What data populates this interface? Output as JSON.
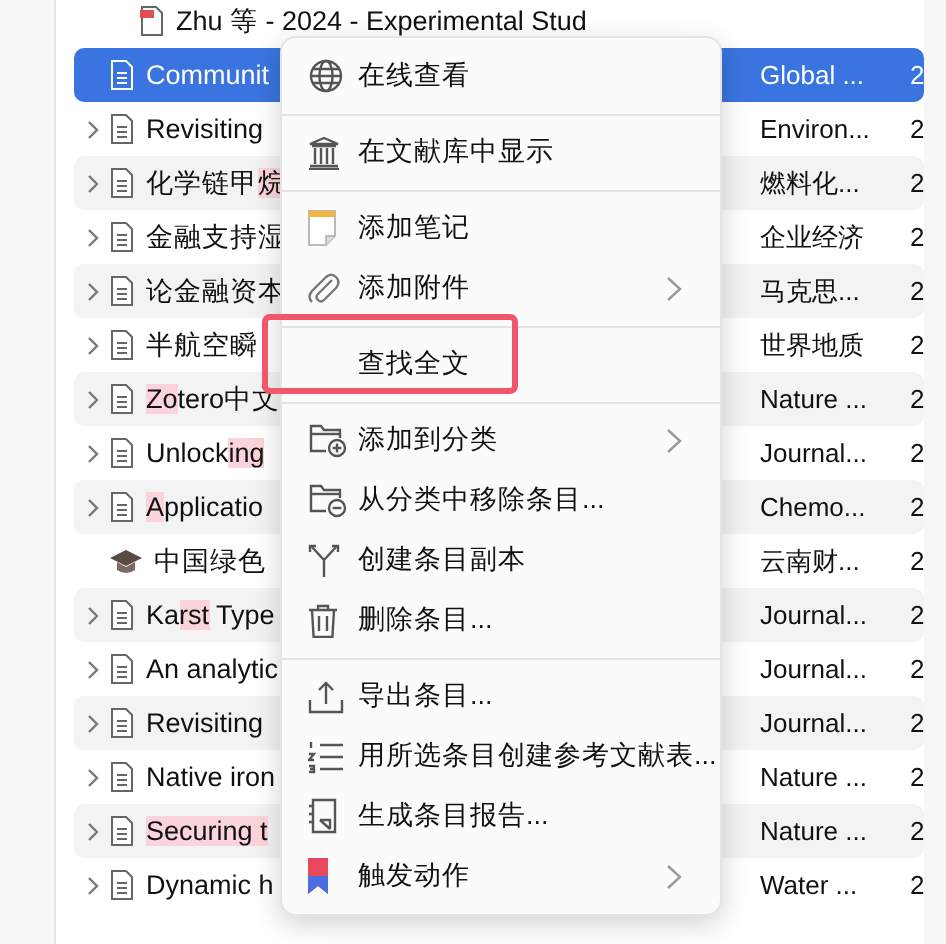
{
  "items": [
    {
      "kind": "attachment",
      "expandable": false,
      "selected": false,
      "title": [
        {
          "text": "Zhu 等 - 2024 - Experimental Stud",
          "hit": false
        }
      ]
    },
    {
      "kind": "article",
      "expandable": false,
      "selected": true,
      "title": [
        {
          "text": "Communit",
          "hit": false
        }
      ],
      "publication": "Global ...",
      "date": "2"
    },
    {
      "kind": "article",
      "expandable": true,
      "selected": false,
      "title": [
        {
          "text": "Revisiting",
          "hit": false
        }
      ],
      "publication": "Environ...",
      "date": "2"
    },
    {
      "kind": "article",
      "expandable": true,
      "selected": false,
      "title": [
        {
          "text": "化学链甲",
          "hit": false
        },
        {
          "text": "烷",
          "hit": true
        }
      ],
      "publication": "燃料化...",
      "date": "2"
    },
    {
      "kind": "article",
      "expandable": true,
      "selected": false,
      "title": [
        {
          "text": "金融支持湿",
          "hit": false
        }
      ],
      "publication": "企业经济",
      "date": "2"
    },
    {
      "kind": "article",
      "expandable": true,
      "selected": false,
      "title": [
        {
          "text": "论金融资本",
          "hit": false
        }
      ],
      "publication": "马克思...",
      "date": "2"
    },
    {
      "kind": "article",
      "expandable": true,
      "selected": false,
      "title": [
        {
          "text": "半航空瞬",
          "hit": false
        }
      ],
      "publication": "世界地质",
      "date": "2"
    },
    {
      "kind": "article",
      "expandable": true,
      "selected": false,
      "title": [
        {
          "text": "Zo",
          "hit": true
        },
        {
          "text": "tero中文",
          "hit": false
        }
      ],
      "publication": "Nature ...",
      "date": "2"
    },
    {
      "kind": "article",
      "expandable": true,
      "selected": false,
      "title": [
        {
          "text": "Unlock",
          "hit": false
        },
        {
          "text": "ing",
          "hit": true
        }
      ],
      "publication": "Journal...",
      "date": "2"
    },
    {
      "kind": "article",
      "expandable": true,
      "selected": false,
      "title": [
        {
          "text": "A",
          "hit": true
        },
        {
          "text": "pplicatio",
          "hit": false
        }
      ],
      "publication": "Chemo...",
      "date": "2"
    },
    {
      "kind": "thesis",
      "expandable": false,
      "selected": false,
      "title": [
        {
          "text": "中国绿色",
          "hit": false
        }
      ],
      "publication": "云南财...",
      "date": "2"
    },
    {
      "kind": "article",
      "expandable": true,
      "selected": false,
      "title": [
        {
          "text": "Ka",
          "hit": false
        },
        {
          "text": "rst",
          "hit": true
        },
        {
          "text": " Type",
          "hit": false
        }
      ],
      "publication": "Journal...",
      "date": "2"
    },
    {
      "kind": "article",
      "expandable": true,
      "selected": false,
      "title": [
        {
          "text": "An analytic",
          "hit": false
        }
      ],
      "publication": "Journal...",
      "date": "2"
    },
    {
      "kind": "article",
      "expandable": true,
      "selected": false,
      "title": [
        {
          "text": "Revisiting",
          "hit": false
        }
      ],
      "publication": "Journal...",
      "date": "2"
    },
    {
      "kind": "article",
      "expandable": true,
      "selected": false,
      "title": [
        {
          "text": "Native iron",
          "hit": false
        }
      ],
      "publication": "Nature ...",
      "date": "2"
    },
    {
      "kind": "article",
      "expandable": true,
      "selected": false,
      "title": [
        {
          "text": "Securing t",
          "hit": true
        }
      ],
      "publication": "Nature ...",
      "date": "2"
    },
    {
      "kind": "article",
      "expandable": true,
      "selected": false,
      "title": [
        {
          "text": "Dynamic h",
          "hit": false
        }
      ],
      "publication": "Water ...",
      "date": "2"
    }
  ],
  "context_menu": [
    {
      "kind": "item",
      "label": "在线查看",
      "submenu": false,
      "outlined": false
    },
    {
      "kind": "separator"
    },
    {
      "kind": "item",
      "label": "在文献库中显示",
      "submenu": false,
      "outlined": false
    },
    {
      "kind": "separator"
    },
    {
      "kind": "item",
      "label": "添加笔记",
      "submenu": false,
      "outlined": false
    },
    {
      "kind": "item",
      "label": "添加附件",
      "submenu": true,
      "outlined": false
    },
    {
      "kind": "separator"
    },
    {
      "kind": "item",
      "label": "查找全文",
      "submenu": false,
      "outlined": true
    },
    {
      "kind": "separator"
    },
    {
      "kind": "item",
      "label": "添加到分类",
      "submenu": true,
      "outlined": false
    },
    {
      "kind": "item",
      "label": "从分类中移除条目...",
      "submenu": false,
      "outlined": false
    },
    {
      "kind": "item",
      "label": "创建条目副本",
      "submenu": false,
      "outlined": false
    },
    {
      "kind": "item",
      "label": "删除条目...",
      "submenu": false,
      "outlined": false
    },
    {
      "kind": "separator"
    },
    {
      "kind": "item",
      "label": "导出条目...",
      "submenu": false,
      "outlined": false
    },
    {
      "kind": "item",
      "label": "用所选条目创建参考文献表...",
      "submenu": false,
      "outlined": false
    },
    {
      "kind": "item",
      "label": "生成条目报告...",
      "submenu": false,
      "outlined": false
    },
    {
      "kind": "item",
      "label": "触发动作",
      "submenu": true,
      "outlined": false
    }
  ]
}
